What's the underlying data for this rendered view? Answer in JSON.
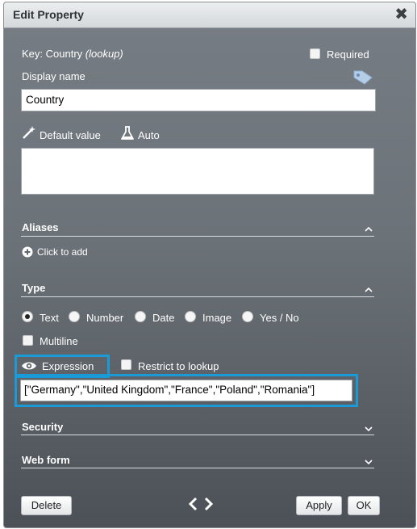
{
  "dialog": {
    "title": "Edit Property",
    "close_symbol": "✖"
  },
  "key": {
    "label": "Key: Country",
    "type": "(lookup)"
  },
  "required_label": "Required",
  "display_name": {
    "label": "Display name",
    "value": "Country"
  },
  "default_value_label": "Default value",
  "auto_label": "Auto",
  "default_value_text": "",
  "aliases": {
    "title": "Aliases",
    "add_label": "Click to add"
  },
  "type_section": {
    "title": "Type",
    "options": [
      "Text",
      "Number",
      "Date",
      "Image",
      "Yes / No"
    ],
    "selected": "Text",
    "multiline_label": "Multiline",
    "expression_label": "Expression",
    "restrict_label": "Restrict to lookup",
    "expression_value": "[\"Germany\",\"United Kingdom\",\"France\",\"Poland\",\"Romania\"]"
  },
  "security": {
    "title": "Security"
  },
  "web_form": {
    "title": "Web form"
  },
  "footer": {
    "delete_label": "Delete",
    "nav_symbol": "‹ ›",
    "apply_label": "Apply",
    "ok_label": "OK"
  },
  "colors": {
    "highlight": "#1a9ad6",
    "dialog_top": "#777d84",
    "dialog_bottom": "#4b5157"
  },
  "icons": [
    "close-icon",
    "tag-icon",
    "magic-wand-icon",
    "flask-icon",
    "plus-circle-icon",
    "eye-icon",
    "chevron-up-icon",
    "chevron-down-icon",
    "prev-icon",
    "next-icon"
  ]
}
